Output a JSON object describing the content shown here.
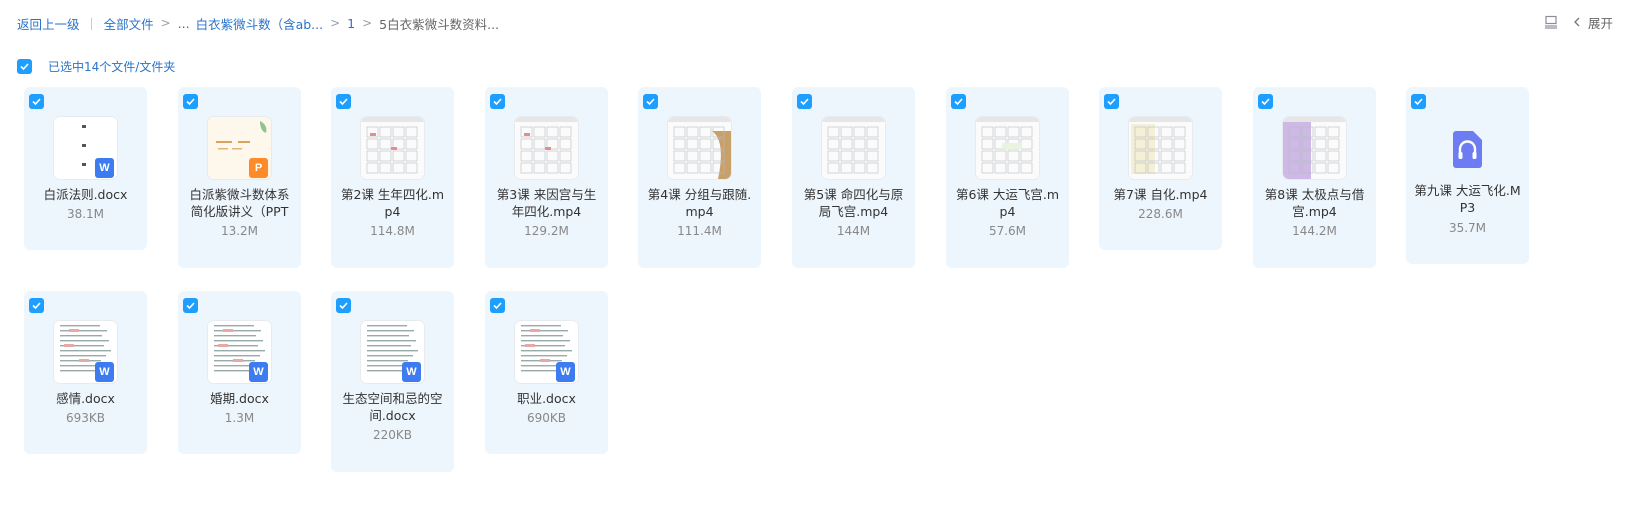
{
  "breadcrumb": {
    "back": "返回上一级",
    "all_files": "全部文件",
    "ellipsis": "...",
    "folder1": "白衣紫微斗数（含ab...",
    "folder2": "1",
    "current": "5白衣紫微斗数资料..."
  },
  "toolbar": {
    "expand_label": "展开"
  },
  "selection": {
    "label": "已选中14个文件/文件夹"
  },
  "colors": {
    "accent": "#1e9fff",
    "link": "#2a74c9",
    "card_bg": "#eef6fd"
  },
  "files": [
    {
      "name": "白派法则.docx",
      "size": "38.1M",
      "type": "docx",
      "icon": "word-doc-icon"
    },
    {
      "name": "白派紫微斗数体系简化版讲义（PPT",
      "size": "13.2M",
      "type": "pptx",
      "icon": "ppt-icon"
    },
    {
      "name": "第2课 生年四化.mp4",
      "size": "114.8M",
      "type": "mp4",
      "icon": "video-thumbnail"
    },
    {
      "name": "第3课 来因宫与生年四化.mp4",
      "size": "129.2M",
      "type": "mp4",
      "icon": "video-thumbnail"
    },
    {
      "name": "第4课 分组与跟随.mp4",
      "size": "111.4M",
      "type": "mp4",
      "icon": "video-thumbnail"
    },
    {
      "name": "第5课 命四化与原局飞宫.mp4",
      "size": "144M",
      "type": "mp4",
      "icon": "video-thumbnail"
    },
    {
      "name": "第6课 大运飞宫.mp4",
      "size": "57.6M",
      "type": "mp4",
      "icon": "video-thumbnail"
    },
    {
      "name": "第7课 自化.mp4",
      "size": "228.6M",
      "type": "mp4",
      "icon": "video-thumbnail"
    },
    {
      "name": "第8课 太极点与借宫.mp4",
      "size": "144.2M",
      "type": "mp4",
      "icon": "video-thumbnail"
    },
    {
      "name": "第九课 大运飞化.MP3",
      "size": "35.7M",
      "type": "mp3",
      "icon": "audio-headphones-icon"
    },
    {
      "name": "感情.docx",
      "size": "693KB",
      "type": "docx",
      "icon": "word-doc-icon"
    },
    {
      "name": "婚期.docx",
      "size": "1.3M",
      "type": "docx",
      "icon": "word-doc-icon"
    },
    {
      "name": "生态空间和忌的空间.docx",
      "size": "220KB",
      "type": "docx",
      "icon": "word-doc-icon"
    },
    {
      "name": "职业.docx",
      "size": "690KB",
      "type": "docx",
      "icon": "word-doc-icon"
    }
  ]
}
